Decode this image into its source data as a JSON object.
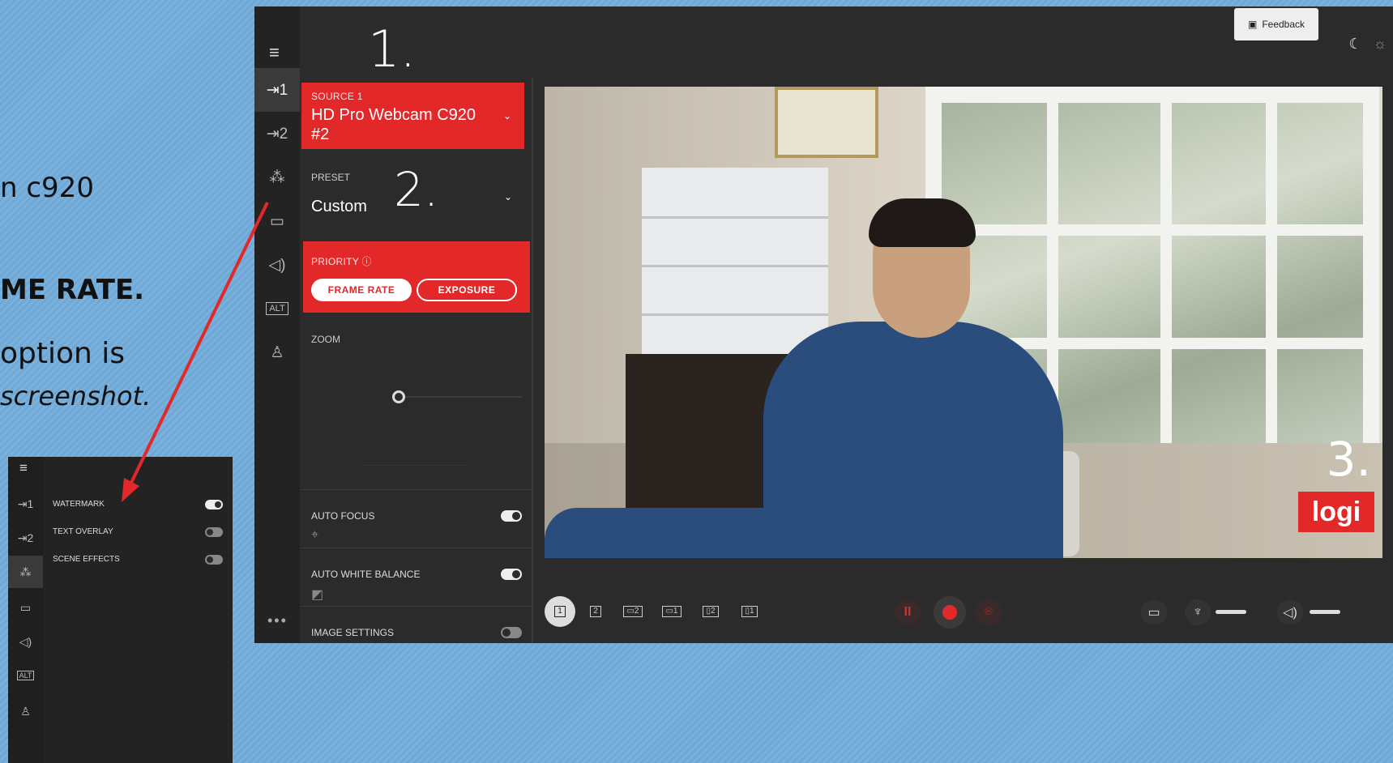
{
  "slide": {
    "line1": "n c920",
    "line2": "ME RATE.",
    "line3": " option is",
    "line4": "screenshot."
  },
  "annotations": {
    "one": "1.",
    "two": "2.",
    "three": "3."
  },
  "app": {
    "nav_icons": [
      "menu-icon",
      "source-1-icon",
      "source-2-icon",
      "effects-icon",
      "camera-icon",
      "audio-icon",
      "alt-icon",
      "profile-icon"
    ],
    "nav_glyphs": {
      "menu": "≡",
      "source1": "⇥1",
      "source2": "⇥2",
      "effects": "⁂",
      "camera": "▭",
      "audio": "◁)",
      "alt": "ALT",
      "profile": "♙",
      "more": "•••"
    },
    "source": {
      "label": "SOURCE 1",
      "name": "HD Pro Webcam C920 #2"
    },
    "preset": {
      "label": "PRESET",
      "value": "Custom"
    },
    "priority": {
      "label": "PRIORITY ⓘ",
      "frame_rate": "FRAME RATE",
      "exposure": "EXPOSURE",
      "selected": "FRAME RATE"
    },
    "zoom": {
      "label": "ZOOM",
      "level": 0
    },
    "auto_focus": {
      "label": "AUTO FOCUS",
      "on": true
    },
    "auto_white_balance": {
      "label": "AUTO WHITE BALANCE",
      "on": true
    },
    "image_settings": {
      "label": "IMAGE SETTINGS",
      "on": false
    },
    "feedback": "Feedback",
    "preview_logo": "logi",
    "layouts": [
      "1",
      "2",
      "▭2",
      "▭1",
      "▯2",
      "▯1"
    ],
    "accent": "#e3282a"
  },
  "mini": {
    "rows": [
      {
        "label": "WATERMARK",
        "on": true
      },
      {
        "label": "TEXT OVERLAY",
        "on": false
      },
      {
        "label": "SCENE EFFECTS",
        "on": false
      }
    ]
  }
}
